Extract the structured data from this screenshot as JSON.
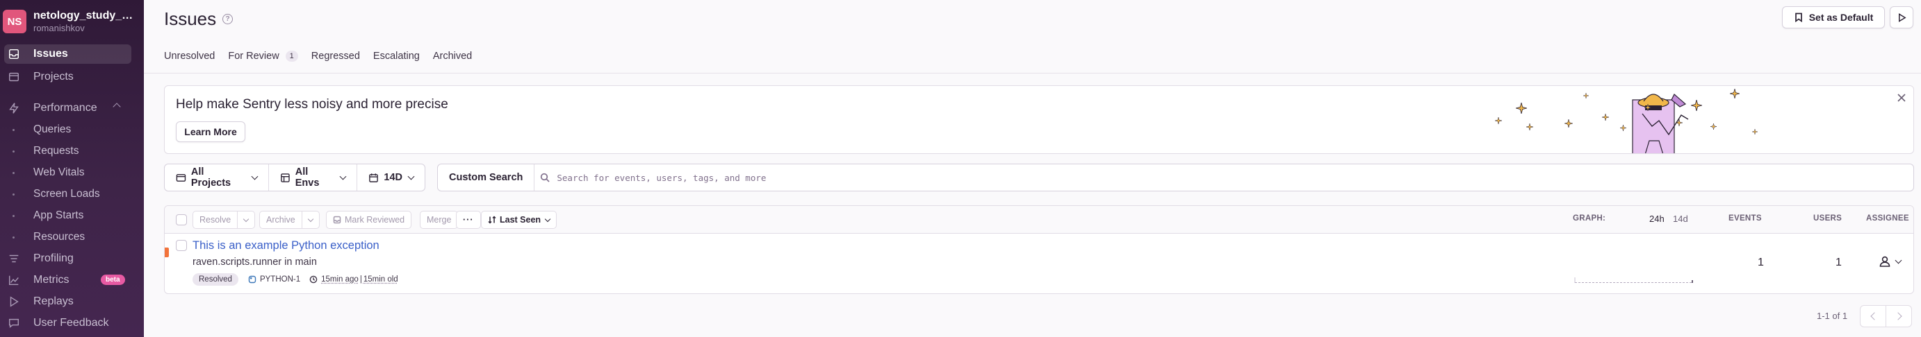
{
  "org": {
    "initials": "NS",
    "name": "netology_study_sentry",
    "user": "romanishkov",
    "avatar_color": "#e1567c"
  },
  "sidebar": {
    "items": [
      {
        "label": "Issues",
        "icon": "issues-icon",
        "active": true
      },
      {
        "label": "Projects",
        "icon": "projects-icon"
      },
      {
        "label": "Performance",
        "icon": "performance-icon"
      },
      {
        "label": "Queries"
      },
      {
        "label": "Requests"
      },
      {
        "label": "Web Vitals"
      },
      {
        "label": "Screen Loads"
      },
      {
        "label": "App Starts"
      },
      {
        "label": "Resources"
      },
      {
        "label": "Profiling",
        "icon": "profiling-icon"
      },
      {
        "label": "Metrics",
        "icon": "metrics-icon",
        "badge": "beta"
      },
      {
        "label": "Replays",
        "icon": "replays-icon"
      },
      {
        "label": "User Feedback",
        "icon": "user-feedback-icon"
      }
    ]
  },
  "header": {
    "title": "Issues",
    "set_default_label": "Set as Default",
    "tabs": [
      {
        "label": "Unresolved"
      },
      {
        "label": "For Review",
        "badge": "1"
      },
      {
        "label": "Regressed"
      },
      {
        "label": "Escalating"
      },
      {
        "label": "Archived"
      }
    ]
  },
  "banner": {
    "title": "Help make Sentry less noisy and more precise",
    "button": "Learn More"
  },
  "filters": {
    "projects": "All Projects",
    "envs": "All Envs",
    "period": "14D",
    "custom_search": "Custom Search",
    "search_placeholder": "Search for events, users, tags, and more"
  },
  "table": {
    "actions": {
      "resolve": "Resolve",
      "archive": "Archive",
      "mark_reviewed": "Mark Reviewed",
      "merge": "Merge",
      "more": "···",
      "sort": "Last Seen"
    },
    "columns": {
      "graph": "Graph:",
      "graph_24h": "24h",
      "graph_14d": "14d",
      "events": "Events",
      "users": "Users",
      "assignee": "Assignee"
    },
    "rows": [
      {
        "title": "This is an example Python exception",
        "culprit": "raven.scripts.runner in main",
        "status": "Resolved",
        "short_id": "PYTHON-1",
        "last_seen": "15min ago",
        "separator": "|",
        "age": "15min old",
        "events": "1",
        "users": "1",
        "level_color": "#f2733b"
      }
    ]
  },
  "pagination": {
    "caption": "1-1 of 1"
  },
  "colors": {
    "accent_link": "#3a5fc8",
    "sidebar_bg": "#3e2448",
    "beta_badge": "#e75aa3"
  }
}
